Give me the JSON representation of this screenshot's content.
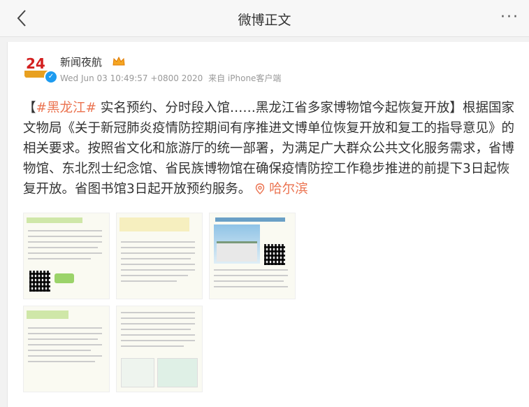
{
  "nav": {
    "title": "微博正文",
    "back_icon": "chevron-left-icon",
    "more_icon": "more-dots-icon"
  },
  "author": {
    "name": "新闻夜航",
    "avatar_text": "24",
    "timestamp": "Wed Jun 03 10:49:57 +0800 2020",
    "source": "来自 iPhone客户端"
  },
  "post": {
    "hashtag": "#黑龙江#",
    "bracket_open": "【",
    "title_text": " 实名预约、分时段入馆……黑龙江省多家博物馆今起恢复开放",
    "bracket_close": "】",
    "body": "根据国家文物局《关于新冠肺炎疫情防控期间有序推进文博单位恢复开放和复工的指导意见》的相关要求。按照省文化和旅游厅的统一部署，为满足广大群众公共文化服务需求，省博物馆、东北烈士纪念馆、省民族博物馆在确保疫情防控工作稳步推进的前提下3日起恢复开放。省图书馆3日起开放预约服务。",
    "location": "哈尔滨"
  },
  "colors": {
    "link": "#eb7350",
    "verified": "#1d9bf0",
    "accent_green": "#6a9a2a"
  }
}
